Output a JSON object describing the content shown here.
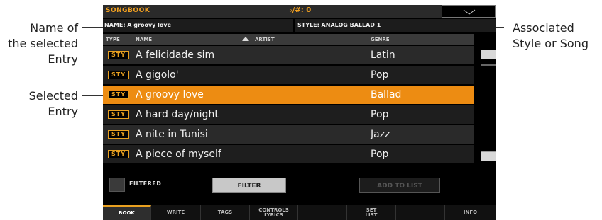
{
  "callouts": {
    "name_selected": [
      "Name of",
      "the selected",
      "Entry"
    ],
    "selected_entry": [
      "Selected",
      "Entry"
    ],
    "associated": [
      "Associated",
      "Style or Song"
    ]
  },
  "header": {
    "title": "SONGBOOK",
    "key": "♭/#: 0"
  },
  "info": {
    "name": "NAME: A groovy love",
    "style": "STYLE: ANALOG BALLAD 1"
  },
  "columns": {
    "type": "TYPE",
    "name": "NAME",
    "artist": "ARTIST",
    "genre": "GENRE"
  },
  "rows": [
    {
      "badge": "STY",
      "name": "A felicidade sim",
      "genre": "Latin",
      "selected": false
    },
    {
      "badge": "STY",
      "name": "A gigolo'",
      "genre": "Pop",
      "selected": false
    },
    {
      "badge": "STY",
      "name": "A groovy love",
      "genre": "Ballad",
      "selected": true
    },
    {
      "badge": "STY",
      "name": "A hard day/night",
      "genre": "Pop",
      "selected": false
    },
    {
      "badge": "STY",
      "name": "A nite in Tunisi",
      "genre": "Jazz",
      "selected": false
    },
    {
      "badge": "STY",
      "name": "A piece of myself",
      "genre": "Pop",
      "selected": false
    }
  ],
  "controls": {
    "filtered": "FILTERED",
    "filter": "FILTER",
    "add_to_list": "ADD TO LIST"
  },
  "tabs": [
    {
      "label": "BOOK",
      "active": true
    },
    {
      "label": "WRITE",
      "active": false
    },
    {
      "label": "TAGS",
      "active": false
    },
    {
      "label": "CONTROLS LYRICS",
      "active": false
    },
    {
      "label": "",
      "active": false
    },
    {
      "label": "SET LIST",
      "active": false
    },
    {
      "label": "",
      "active": false
    },
    {
      "label": "INFO",
      "active": false
    }
  ],
  "colors": {
    "accent": "#ed8c12",
    "badge": "#e8a020",
    "screen_bg": "#000000"
  }
}
